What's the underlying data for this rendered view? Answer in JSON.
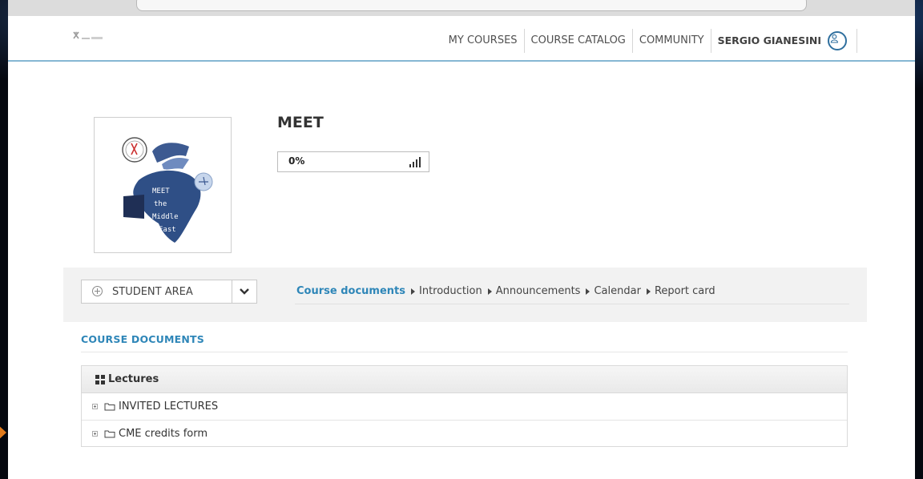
{
  "header": {
    "nav": [
      "MY COURSES",
      "COURSE CATALOG",
      "COMMUNITY"
    ],
    "user_name": "SERGIO GIANESINI"
  },
  "course": {
    "title": "MEET",
    "progress_label": "0%",
    "progress": 0,
    "thumbnail_text": [
      "MEET",
      "the",
      "Middle",
      "East"
    ]
  },
  "toolbar": {
    "area_label": "STUDENT AREA",
    "breadcrumbs": [
      "Course documents",
      "Introduction",
      "Announcements",
      "Calendar",
      "Report card"
    ]
  },
  "documents": {
    "section_title": "COURSE DOCUMENTS",
    "panel_title": "Lectures",
    "folders": [
      "INVITED LECTURES",
      "CME credits form"
    ]
  },
  "colors": {
    "accent": "#2e86b8",
    "map_blue": "#2f4f86",
    "header_rule": "#86b7d3",
    "highlight_arrow": "#e07a1c"
  },
  "icons": {
    "user": "user-icon",
    "progress": "signal-bars-icon",
    "area": "plus-circle-icon",
    "dropdown": "chevron-down-icon",
    "panel": "grid-icon",
    "folder": "folder-icon"
  }
}
